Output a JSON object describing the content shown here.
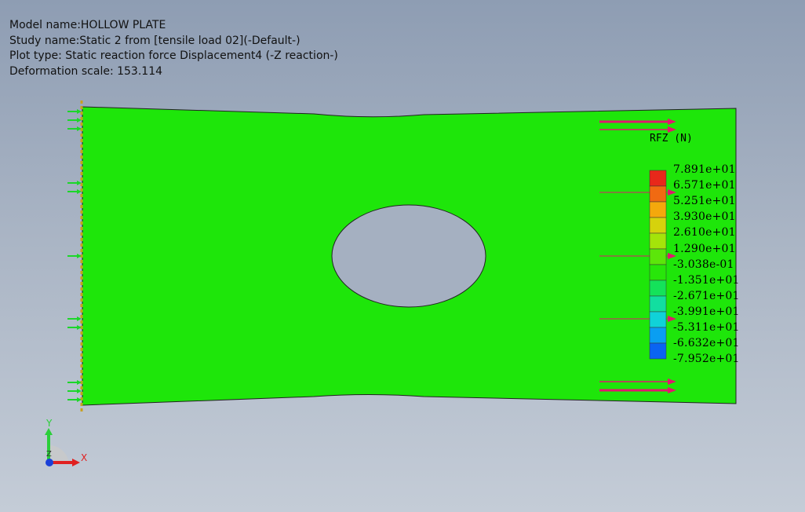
{
  "header": {
    "model_name": "Model name:HOLLOW PLATE",
    "study_name": "Study name:Static 2 from [tensile load 02](-Default-)",
    "plot_type": "Plot type: Static reaction force Displacement4 (-Z reaction-)",
    "deformation_scale": "Deformation scale: 153.114"
  },
  "legend": {
    "title": "RFZ (N)",
    "labels": [
      "7.891e+01",
      "6.571e+01",
      "5.251e+01",
      "3.930e+01",
      "2.610e+01",
      "1.290e+01",
      "-3.038e-01",
      "-1.351e+01",
      "-2.671e+01",
      "-3.991e+01",
      "-5.311e+01",
      "-6.632e+01",
      "-7.952e+01"
    ],
    "colors": [
      "#e8281a",
      "#f06a12",
      "#f4a80c",
      "#d6d20c",
      "#a4e40a",
      "#5ce60a",
      "#28e60a",
      "#14e25a",
      "#12dea0",
      "#10d2d8",
      "#0a9ef2",
      "#0a64f2",
      "#0a26f0"
    ]
  },
  "model": {
    "fill_color": "#1ee60a",
    "load_arrow_color": "#e0186e",
    "fixture_arrow_color": "#1cd62a"
  },
  "triad": {
    "x_label": "X",
    "y_label": "Y",
    "z_label": "Z"
  }
}
